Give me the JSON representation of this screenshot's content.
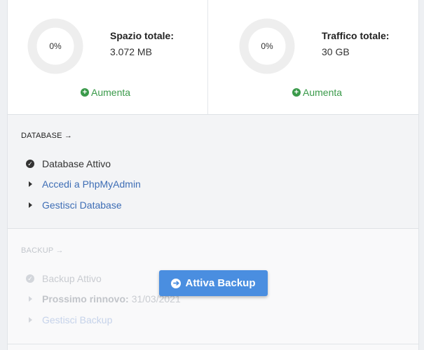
{
  "usage": {
    "space": {
      "percent_label": "0%",
      "percent": 0,
      "title": "Spazio totale:",
      "value": "3.072 MB",
      "increase_label": "Aumenta"
    },
    "traffic": {
      "percent_label": "0%",
      "percent": 0,
      "title": "Traffico totale:",
      "value": "30 GB",
      "increase_label": "Aumenta"
    }
  },
  "database": {
    "title": "DATABASE →",
    "status": "Database Attivo",
    "link_phpmyadmin": "Accedi a PhpMyAdmin",
    "link_manage": "Gestisci Database"
  },
  "backup": {
    "title": "BACKUP →",
    "status": "Backup Attivo",
    "renewal_label": "Prossimo rinnovo:",
    "renewal_date": "31/03/2021",
    "link_manage": "Gestisci Backup",
    "cta_label": "Attiva Backup"
  },
  "colors": {
    "accent_green": "#3a9a4a",
    "link_blue": "#3d6db5",
    "button_blue": "#4a8ee0",
    "donut_track": "#eeeeee"
  },
  "icons": {
    "increase": "plus-circle-icon",
    "status": "check-circle-icon",
    "list": "caret-right-icon",
    "cta": "arrow-circle-right-icon"
  }
}
